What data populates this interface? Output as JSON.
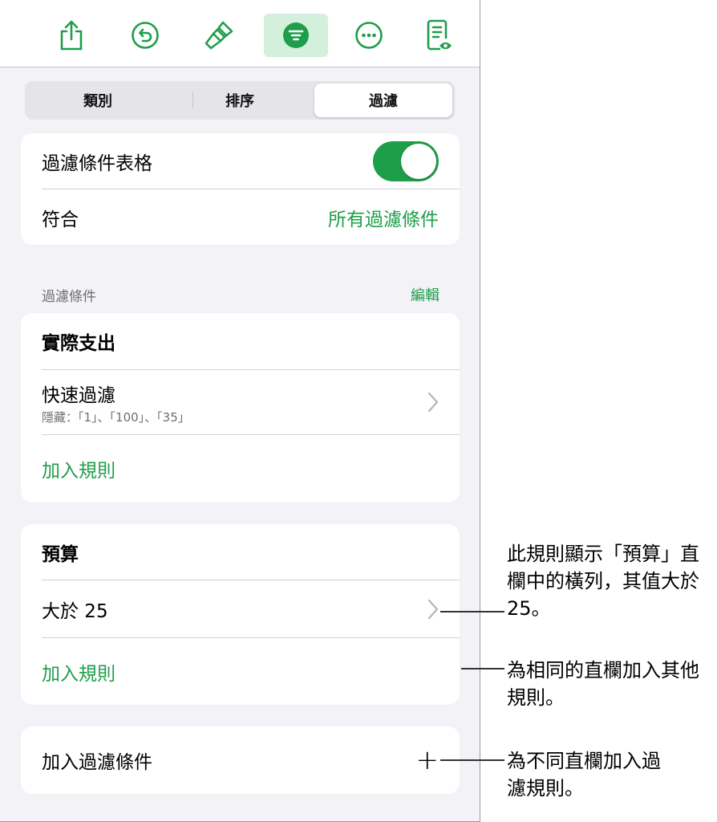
{
  "toolbar": {
    "icons": [
      "share-icon",
      "undo-icon",
      "paintbrush-icon",
      "filter-icon",
      "more-icon",
      "reading-view-icon"
    ],
    "accent": "#1e9e4a",
    "active_bg": "#d3f0dc"
  },
  "tabs": [
    "類別",
    "排序",
    "過濾"
  ],
  "filter_table": {
    "label": "過濾條件表格",
    "enabled": true,
    "match_label": "符合",
    "match_value": "所有過濾條件"
  },
  "filters_section": {
    "header": "過濾條件",
    "edit": "編輯"
  },
  "filter_groups": [
    {
      "column": "實際支出",
      "rule_title": "快速過濾",
      "rule_detail": "隱藏：「1」、「100」、「35」",
      "add_rule": "加入規則"
    },
    {
      "column": "預算",
      "rule_title": "大於 25",
      "add_rule": "加入規則"
    }
  ],
  "add_filter": "加入過濾條件",
  "add_filter_symbol": "+",
  "callouts": [
    "此規則顯示「預算」直欄中的橫列，其值大於 25。",
    "為相同的直欄加入其他規則。",
    "為不同直欄加入過濾規則。"
  ]
}
